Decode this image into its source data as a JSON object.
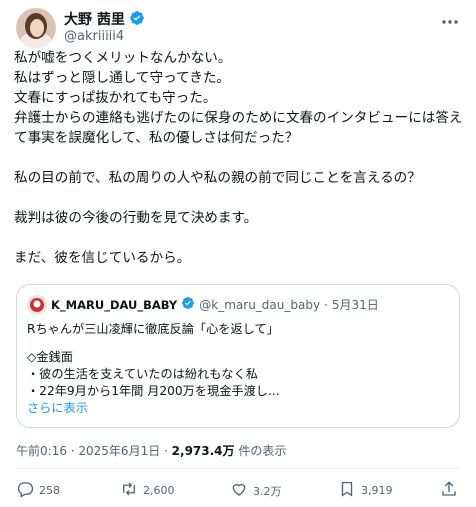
{
  "author": {
    "display_name": "大野 茜里",
    "handle": "@akriiiii4",
    "avatar": "avatar-photo"
  },
  "post": {
    "lines": [
      "私が嘘をつくメリットなんかない。",
      "私はずっと隠し通して守ってきた。",
      "文春にすっぱ抜かれても守った。",
      "弁護士からの連絡も逃げたのに保身のために文春のインタビューには答え",
      "て事実を誤魔化して、私の優しさは何だった？",
      "",
      "私の目の前で、私の周りの人や私の親の前で同じことを言えるの？",
      "",
      "裁判は彼の今後の行動を見て決めます。",
      "",
      "まだ、彼を信じているから。"
    ]
  },
  "quote": {
    "name": "K_MARU_DAU_BABY",
    "handle": "@k_maru_dau_baby",
    "separator": "·",
    "date": "5月31日",
    "lines": [
      "Rちゃんが三山凌輝に徹底反論「心を返して」",
      "",
      "◇金銭面",
      "・彼の生活を支えていたのは紛れもなく私",
      "・22年9月から1年間 月200万を現金手渡し..."
    ],
    "show_more": "さらに表示"
  },
  "meta": {
    "time": "午前0:16 · 2025年6月1日 · ",
    "views": "2,973.4万",
    "views_suffix": " 件の表示"
  },
  "actions": {
    "reply": "258",
    "repost": "2,600",
    "like": "3.2万",
    "bookmark": "3,919"
  },
  "colors": {
    "verified": "#1d9bf0",
    "text": "#0f1419",
    "secondary": "#536471",
    "border": "#cfd9de"
  }
}
